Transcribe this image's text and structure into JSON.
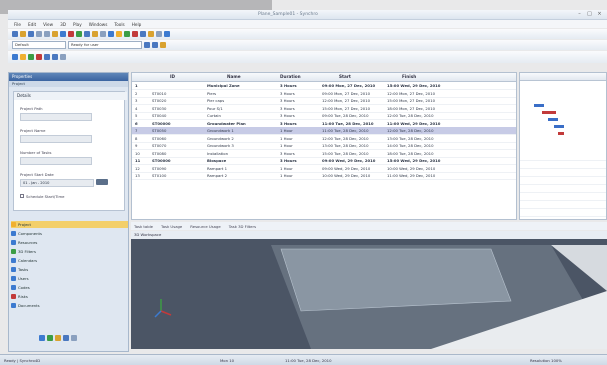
{
  "window": {
    "title": "Plane_Sample01 - Synchro"
  },
  "menu": [
    "File",
    "Edit",
    "View",
    "3D",
    "Play",
    "Windows",
    "Tools",
    "Help"
  ],
  "toolbar2": {
    "left_combo": "Default",
    "mid_combo": "Ready for user"
  },
  "left_panel": {
    "title": "Properties",
    "subtitle": "Project",
    "section": "Details",
    "fields": [
      "Project Path",
      "Project Name",
      "Number of Tasks",
      "Project Start Date"
    ],
    "date_value": "01 - Jan - 2010",
    "checkbox_label": "Schedule Start/Time"
  },
  "nav": [
    {
      "label": "Project",
      "color": "#f0b030"
    },
    {
      "label": "Components",
      "color": "#3c7ad0"
    },
    {
      "label": "Resources",
      "color": "#3c7ad0"
    },
    {
      "label": "3D Filters",
      "color": "#3c9d45"
    },
    {
      "label": "Calendars",
      "color": "#3c7ad0"
    },
    {
      "label": "Tasks",
      "color": "#3c7ad0"
    },
    {
      "label": "Users",
      "color": "#3c7ad0"
    },
    {
      "label": "Codes",
      "color": "#3c7ad0"
    },
    {
      "label": "Risks",
      "color": "#c23a3a"
    },
    {
      "label": "Documents",
      "color": "#3c7ad0"
    }
  ],
  "grid": {
    "headers": [
      "ID",
      "Name",
      "Duration",
      "Start",
      "Finish"
    ],
    "rows": [
      {
        "n": "1",
        "id": "",
        "name": "Municipal Zone",
        "dur": "3 Hours",
        "start": "09:00 Mon, 27 Dec, 2010",
        "finish": "15:00 Wed, 29 Dec, 2010",
        "bold": true,
        "sel": false
      },
      {
        "n": "2",
        "id": "ST0010",
        "name": "Piers",
        "dur": "3 Hours",
        "start": "09:00 Mon, 27 Dec, 2010",
        "finish": "12:00 Mon, 27 Dec, 2010",
        "bold": false,
        "sel": false
      },
      {
        "n": "3",
        "id": "ST0020",
        "name": "Pier caps",
        "dur": "3 Hours",
        "start": "12:00 Mon, 27 Dec, 2010",
        "finish": "15:00 Mon, 27 Dec, 2010",
        "bold": false,
        "sel": false
      },
      {
        "n": "4",
        "id": "ST0030",
        "name": "Pour S/1",
        "dur": "3 Hours",
        "start": "15:00 Mon, 27 Dec, 2010",
        "finish": "18:00 Mon, 27 Dec, 2010",
        "bold": false,
        "sel": false
      },
      {
        "n": "5",
        "id": "ST0040",
        "name": "Curtain",
        "dur": "3 Hours",
        "start": "09:00 Tue, 28 Dec, 2010",
        "finish": "12:00 Tue, 28 Dec, 2010",
        "bold": false,
        "sel": false
      },
      {
        "n": "6",
        "id": "ST00000",
        "name": "Groundwater Plan",
        "dur": "3 Hours",
        "start": "11:00 Tue, 28 Dec, 2010",
        "finish": "11:00 Wed, 29 Dec, 2010",
        "bold": true,
        "sel": false
      },
      {
        "n": "7",
        "id": "ST0050",
        "name": "Groundwork 1",
        "dur": "1 Hour",
        "start": "11:00 Tue, 28 Dec, 2010",
        "finish": "12:00 Tue, 28 Dec, 2010",
        "bold": false,
        "sel": true
      },
      {
        "n": "8",
        "id": "ST0060",
        "name": "Groundwork 2",
        "dur": "1 Hour",
        "start": "12:00 Tue, 28 Dec, 2010",
        "finish": "13:00 Tue, 28 Dec, 2010",
        "bold": false,
        "sel": false
      },
      {
        "n": "9",
        "id": "ST0070",
        "name": "Groundwork 3",
        "dur": "1 Hour",
        "start": "13:00 Tue, 28 Dec, 2010",
        "finish": "14:00 Tue, 28 Dec, 2010",
        "bold": false,
        "sel": false
      },
      {
        "n": "10",
        "id": "ST0080",
        "name": "Installation",
        "dur": "3 Hours",
        "start": "15:00 Tue, 28 Dec, 2010",
        "finish": "18:00 Tue, 28 Dec, 2010",
        "bold": false,
        "sel": false
      },
      {
        "n": "11",
        "id": "ST00000",
        "name": "Biospace",
        "dur": "3 Hours",
        "start": "09:00 Wed, 29 Dec, 2010",
        "finish": "15:00 Wed, 29 Dec, 2010",
        "bold": true,
        "sel": false
      },
      {
        "n": "12",
        "id": "ST0090",
        "name": "Rampart 1",
        "dur": "1 Hour",
        "start": "09:00 Wed, 29 Dec, 2010",
        "finish": "10:00 Wed, 29 Dec, 2010",
        "bold": false,
        "sel": false
      },
      {
        "n": "13",
        "id": "ST0100",
        "name": "Rampart 2",
        "dur": "1 Hour",
        "start": "10:00 Wed, 29 Dec, 2010",
        "finish": "11:00 Wed, 29 Dec, 2010",
        "bold": false,
        "sel": false
      }
    ]
  },
  "tabs": [
    "Task table",
    "Task Usage",
    "Resource Usage",
    "Task 3D Filters"
  ],
  "view": {
    "title": "3D Workspace"
  },
  "status": {
    "left": "Ready | Synchro4D",
    "mid1": "Mon 10",
    "mid2": "11:00 Tue, 28 Dec, 2010",
    "right": "Resolution 100%"
  }
}
